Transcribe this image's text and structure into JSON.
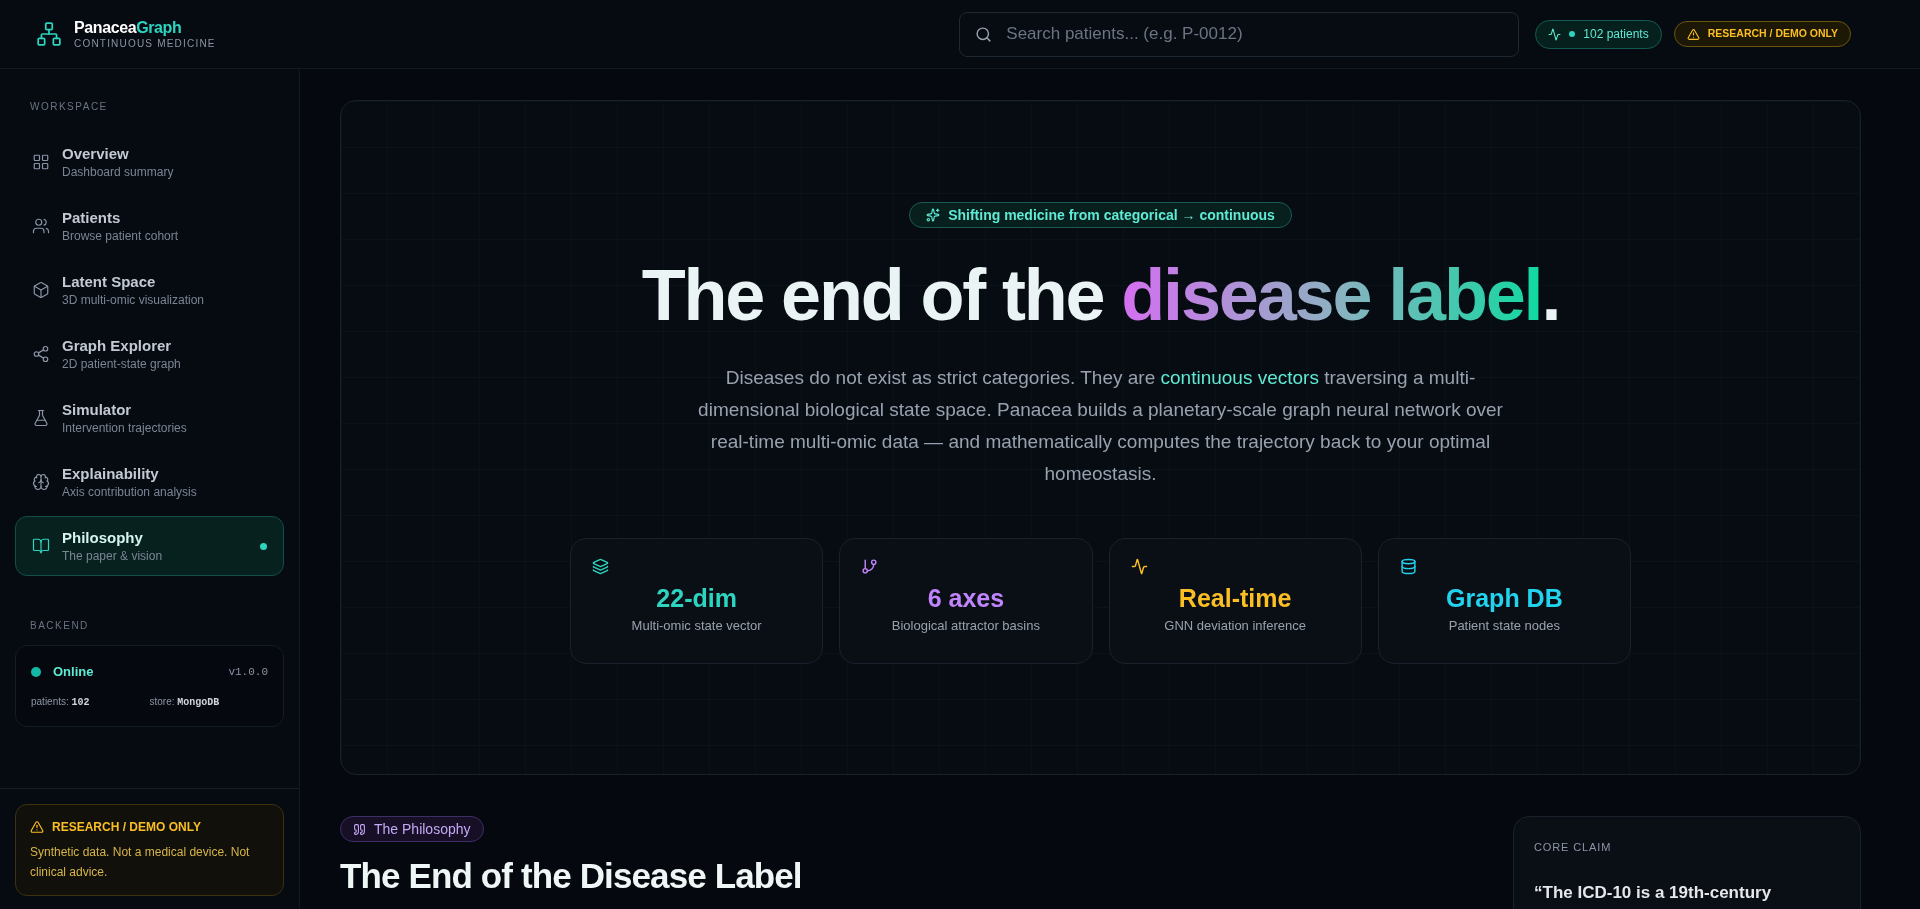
{
  "brand": {
    "name": "Panacea",
    "name_accent": "Graph",
    "tagline": "CONTINUOUS MEDICINE"
  },
  "search": {
    "placeholder": "Search patients... (e.g. P-0012)"
  },
  "patients_badge": "102 patients",
  "demo_badge": "RESEARCH / DEMO ONLY",
  "sidebar": {
    "section": "WORKSPACE",
    "items": [
      {
        "title": "Overview",
        "subtitle": "Dashboard summary",
        "selected": false
      },
      {
        "title": "Patients",
        "subtitle": "Browse patient cohort",
        "selected": false
      },
      {
        "title": "Latent Space",
        "subtitle": "3D multi-omic visualization",
        "selected": false
      },
      {
        "title": "Graph Explorer",
        "subtitle": "2D patient-state graph",
        "selected": false
      },
      {
        "title": "Simulator",
        "subtitle": "Intervention trajectories",
        "selected": false
      },
      {
        "title": "Explainability",
        "subtitle": "Axis contribution analysis",
        "selected": false
      },
      {
        "title": "Philosophy",
        "subtitle": "The paper & vision",
        "selected": true
      }
    ],
    "backend_section": "BACKEND",
    "backend": {
      "status": "Online",
      "online": true,
      "version": "v1.0.0",
      "stats": [
        {
          "label": "patients:",
          "value": "102"
        },
        {
          "label": "store:",
          "value": "MongoDB"
        }
      ]
    },
    "warning": {
      "title": "RESEARCH / DEMO ONLY",
      "text": "Synthetic data. Not a medical device. Not clinical advice."
    }
  },
  "hero": {
    "badge": "Shifting medicine from categorical → continuous",
    "headline": {
      "plain": "The end of the ",
      "highlight": "disease label",
      "end": "."
    },
    "paragraph": [
      {
        "kind": "plain",
        "text": "Diseases do not exist as strict categories. They are "
      },
      {
        "kind": "accent",
        "text": "continuous vectors"
      },
      {
        "kind": "plain",
        "text": " traversing a multi-dimensional biological state space. Panacea builds a planetary-scale graph neural network over real-time multi-omic data — and mathematically computes the trajectory back to your optimal homeostasis."
      }
    ],
    "stats": [
      {
        "value": "22-dim",
        "label": "Multi-omic state vector",
        "color": "#2dd4bf"
      },
      {
        "value": "6 axes",
        "label": "Biological attractor basins",
        "color": "#c084fc"
      },
      {
        "value": "Real-time",
        "label": "GNN deviation inference",
        "color": "#fbbf24"
      },
      {
        "value": "Graph DB",
        "label": "Patient state nodes",
        "color": "#22d3ee"
      }
    ]
  },
  "philosophy": {
    "chip": "The Philosophy",
    "heading": "The End of the Disease Label"
  },
  "core_claim": {
    "label": "CORE CLAIM",
    "quote": "“The ICD-10 is a 19th-century"
  }
}
